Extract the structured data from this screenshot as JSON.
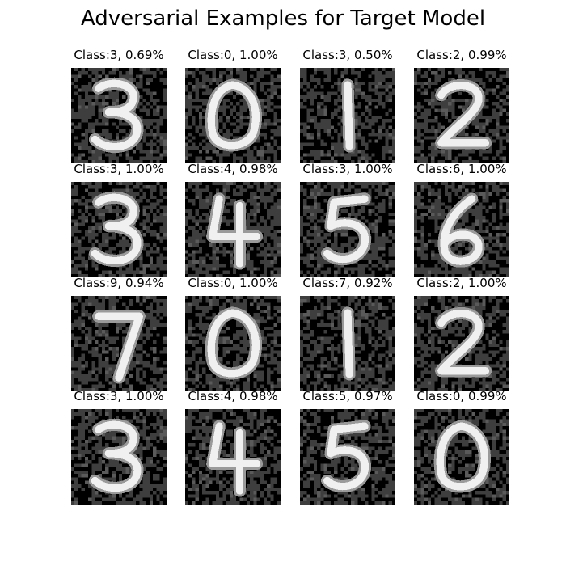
{
  "title": "Adversarial Examples for Target Model",
  "chart_data": {
    "type": "image_grid",
    "rows": 4,
    "cols": 4,
    "colormap": "gray",
    "cells": [
      {
        "label": "Class:3, 0.69%",
        "digit": "3",
        "predicted_class": 3,
        "confidence": 0.69
      },
      {
        "label": "Class:0, 1.00%",
        "digit": "0",
        "predicted_class": 0,
        "confidence": 1.0
      },
      {
        "label": "Class:3, 0.50%",
        "digit": "1",
        "predicted_class": 3,
        "confidence": 0.5
      },
      {
        "label": "Class:2, 0.99%",
        "digit": "2",
        "predicted_class": 2,
        "confidence": 0.99
      },
      {
        "label": "Class:3, 1.00%",
        "digit": "3",
        "predicted_class": 3,
        "confidence": 1.0
      },
      {
        "label": "Class:4, 0.98%",
        "digit": "4",
        "predicted_class": 4,
        "confidence": 0.98
      },
      {
        "label": "Class:3, 1.00%",
        "digit": "5",
        "predicted_class": 3,
        "confidence": 1.0
      },
      {
        "label": "Class:6, 1.00%",
        "digit": "6",
        "predicted_class": 6,
        "confidence": 1.0
      },
      {
        "label": "Class:9, 0.94%",
        "digit": "7",
        "predicted_class": 9,
        "confidence": 0.94
      },
      {
        "label": "Class:0, 1.00%",
        "digit": "0",
        "predicted_class": 0,
        "confidence": 1.0
      },
      {
        "label": "Class:7, 0.92%",
        "digit": "1",
        "predicted_class": 7,
        "confidence": 0.92
      },
      {
        "label": "Class:2, 1.00%",
        "digit": "2",
        "predicted_class": 2,
        "confidence": 1.0
      },
      {
        "label": "Class:3, 1.00%",
        "digit": "3",
        "predicted_class": 3,
        "confidence": 1.0
      },
      {
        "label": "Class:4, 0.98%",
        "digit": "4",
        "predicted_class": 4,
        "confidence": 0.98
      },
      {
        "label": "Class:5, 0.97%",
        "digit": "5",
        "predicted_class": 5,
        "confidence": 0.97
      },
      {
        "label": "Class:0, 0.99%",
        "digit": "0",
        "predicted_class": 0,
        "confidence": 0.99
      }
    ]
  }
}
